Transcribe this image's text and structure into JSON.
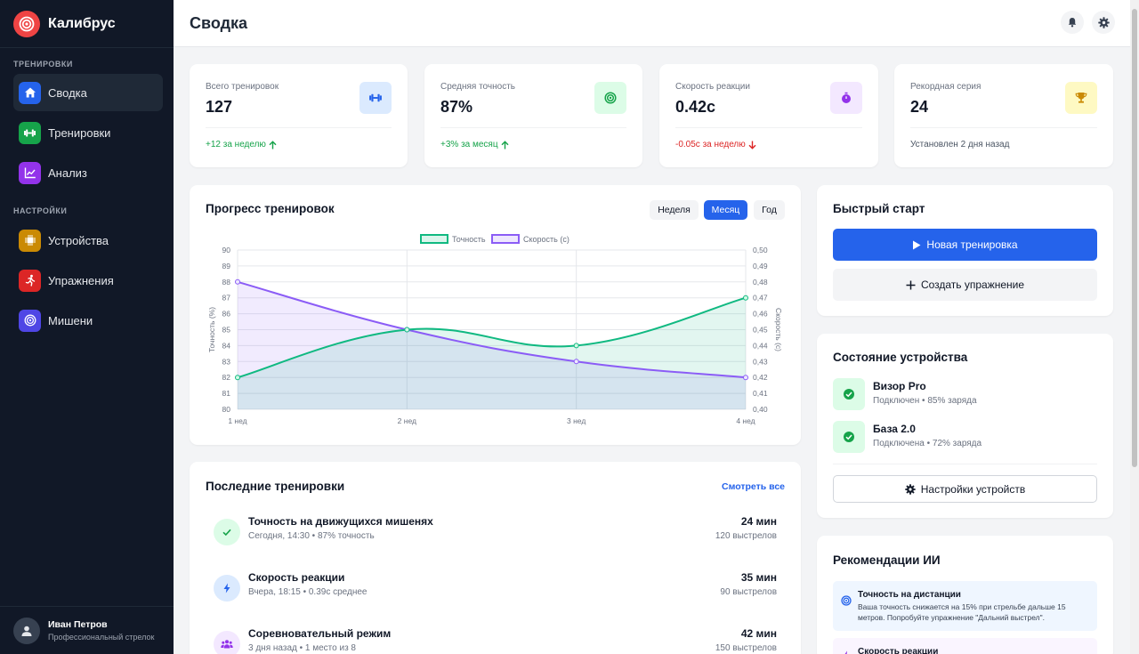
{
  "app": {
    "name": "Калибрус"
  },
  "sidebar": {
    "section_training": "ТРЕНИРОВКИ",
    "section_settings": "НАСТРОЙКИ",
    "items": [
      {
        "label": "Сводка",
        "icon": "home-icon",
        "color": "#2563eb"
      },
      {
        "label": "Тренировки",
        "icon": "dumbbell-icon",
        "color": "#16a34a"
      },
      {
        "label": "Анализ",
        "icon": "chart-icon",
        "color": "#9333ea"
      },
      {
        "label": "Устройства",
        "icon": "chip-icon",
        "color": "#ca8a04"
      },
      {
        "label": "Упражнения",
        "icon": "runner-icon",
        "color": "#dc2626"
      },
      {
        "label": "Мишени",
        "icon": "target-icon",
        "color": "#4f46e5"
      }
    ]
  },
  "profile": {
    "name": "Иван Петров",
    "role": "Профессиональный стрелок"
  },
  "header": {
    "title": "Сводка"
  },
  "stats": [
    {
      "label": "Всего тренировок",
      "value": "127",
      "footer": "+12 за неделю",
      "trend": "up",
      "icon": "dumbbell-icon",
      "icon_bg": "#dbeafe",
      "icon_color": "#2563eb"
    },
    {
      "label": "Средняя точность",
      "value": "87%",
      "footer": "+3% за месяц",
      "trend": "up",
      "icon": "target-icon",
      "icon_bg": "#dcfce7",
      "icon_color": "#16a34a"
    },
    {
      "label": "Скорость реакции",
      "value": "0.42с",
      "footer": "-0.05с за неделю",
      "trend": "down",
      "icon": "stopwatch-icon",
      "icon_bg": "#f3e8ff",
      "icon_color": "#9333ea"
    },
    {
      "label": "Рекордная серия",
      "value": "24",
      "footer": "Установлен 2 дня назад",
      "trend": "none",
      "icon": "trophy-icon",
      "icon_bg": "#fef9c3",
      "icon_color": "#ca8a04"
    }
  ],
  "progress": {
    "title": "Прогресс тренировок",
    "periods": [
      "Неделя",
      "Месяц",
      "Год"
    ],
    "active_period": "Месяц"
  },
  "chart_data": {
    "type": "line",
    "x": [
      "1 нед",
      "2 нед",
      "3 нед",
      "4 нед"
    ],
    "series": [
      {
        "name": "Точность",
        "axis": "left",
        "values": [
          82,
          85,
          84,
          87
        ],
        "color": "#10b981"
      },
      {
        "name": "Скорость (с)",
        "axis": "right",
        "values": [
          0.48,
          0.45,
          0.43,
          0.42
        ],
        "color": "#8b5cf6"
      }
    ],
    "ylabel": "Точность (%)",
    "y2label": "Скорость (с)",
    "ylim": [
      80,
      90
    ],
    "y2lim": [
      0.4,
      0.5
    ],
    "yticks": [
      "90",
      "89",
      "88",
      "87",
      "86",
      "85",
      "84",
      "83",
      "82",
      "81",
      "80"
    ],
    "y2ticks": [
      "0,50",
      "0,49",
      "0,48",
      "0,47",
      "0,46",
      "0,45",
      "0,44",
      "0,43",
      "0,42",
      "0,41",
      "0,40"
    ],
    "legend": "top-center",
    "grid": true
  },
  "recent": {
    "title": "Последние тренировки",
    "view_all": "Смотреть все",
    "items": [
      {
        "title": "Точность на движущихся мишенях",
        "sub": "Сегодня, 14:30 • 87% точность",
        "duration": "24 мин",
        "shots": "120 выстрелов",
        "icon": "check-icon",
        "bg": "#dcfce7",
        "color": "#16a34a"
      },
      {
        "title": "Скорость реакции",
        "sub": "Вчера, 18:15 • 0.39с среднее",
        "duration": "35 мин",
        "shots": "90 выстрелов",
        "icon": "bolt-icon",
        "bg": "#dbeafe",
        "color": "#2563eb"
      },
      {
        "title": "Соревновательный режим",
        "sub": "3 дня назад • 1 место из 8",
        "duration": "42 мин",
        "shots": "150 выстрелов",
        "icon": "users-icon",
        "bg": "#f3e8ff",
        "color": "#9333ea"
      }
    ]
  },
  "quick_start": {
    "title": "Быстрый старт",
    "primary": "Новая тренировка",
    "secondary": "Создать упражнение"
  },
  "devices": {
    "title": "Состояние устройства",
    "items": [
      {
        "name": "Визор Pro",
        "status": "Подключен • 85% заряда"
      },
      {
        "name": "База 2.0",
        "status": "Подключена • 72% заряда"
      }
    ],
    "settings_button": "Настройки устройств"
  },
  "ai": {
    "title": "Рекомендации ИИ",
    "items": [
      {
        "title": "Точность на дистанции",
        "text": "Ваша точность снижается на 15% при стрельбе дальше 15 метров. Попробуйте упражнение \"Дальний выстрел\"."
      },
      {
        "title": "Скорость реакции",
        "text": ""
      }
    ]
  }
}
